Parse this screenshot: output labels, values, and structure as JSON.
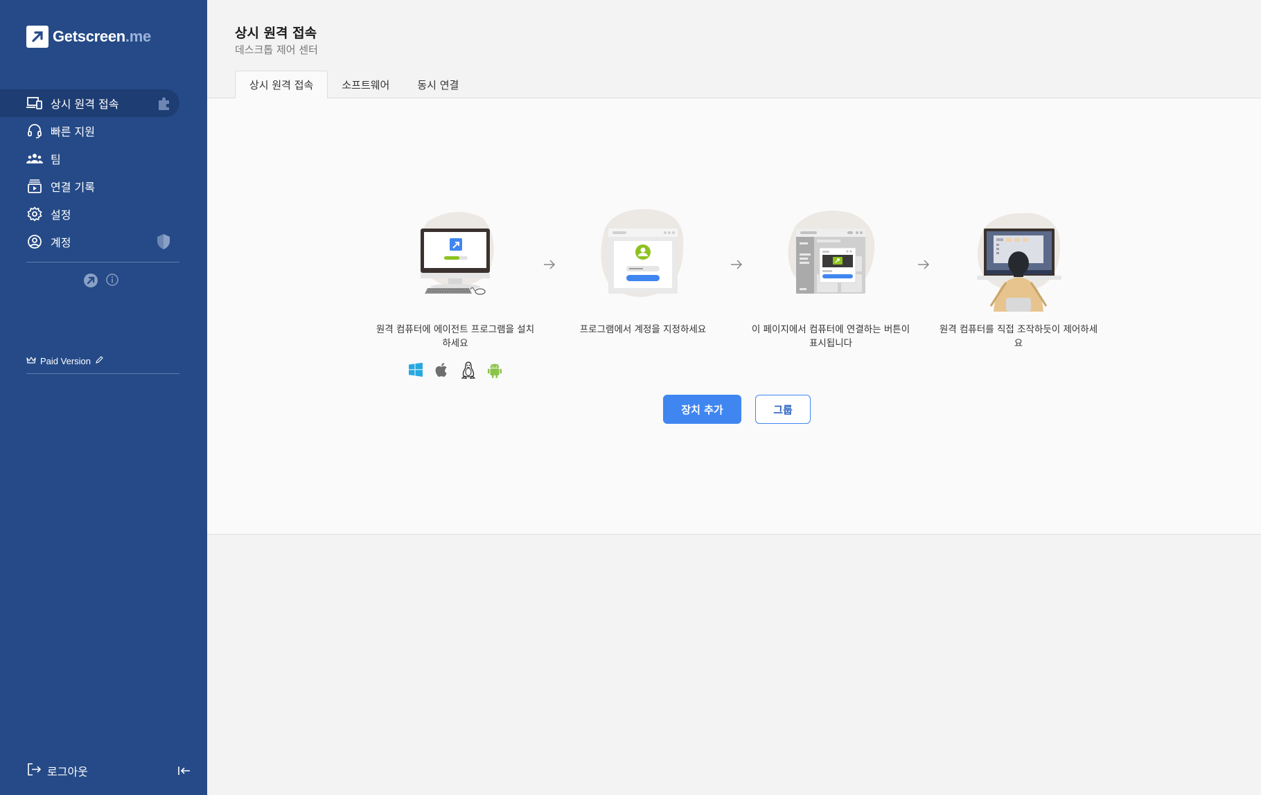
{
  "sidebar": {
    "logo": {
      "brand": "Getscreen",
      "suffix": ".me"
    },
    "items": [
      {
        "label": "상시 원격 접속",
        "icon": "devices-icon",
        "active": true
      },
      {
        "label": "빠른 지원",
        "icon": "headset-icon",
        "active": false
      },
      {
        "label": "팀",
        "icon": "team-icon",
        "active": false
      },
      {
        "label": "연결 기록",
        "icon": "history-icon",
        "active": false
      },
      {
        "label": "설정",
        "icon": "gear-icon",
        "active": false
      },
      {
        "label": "계정",
        "icon": "account-icon",
        "active": false
      }
    ],
    "paid_label": "Paid Version",
    "logout_label": "로그아웃"
  },
  "header": {
    "title": "상시 원격 접속",
    "subtitle": "데스크톱 제어 센터"
  },
  "tabs": [
    {
      "label": "상시 원격 접속",
      "active": true
    },
    {
      "label": "소프트웨어",
      "active": false
    },
    {
      "label": "동시 연결",
      "active": false
    }
  ],
  "steps": [
    {
      "caption": "원격 컴퓨터에 에이전트 프로그램을 설치하세요"
    },
    {
      "caption": "프로그램에서 계정을 지정하세요"
    },
    {
      "caption": "이 페이지에서 컴퓨터에 연결하는 버튼이 표시됩니다"
    },
    {
      "caption": "원격 컴퓨터를 직접 조작하듯이 제어하세요"
    }
  ],
  "os_icons": [
    "windows-icon",
    "apple-icon",
    "linux-icon",
    "android-icon"
  ],
  "actions": {
    "add_device": "장치 추가",
    "group": "그룹"
  },
  "colors": {
    "sidebar_bg": "#254a87",
    "sidebar_active": "#1e3d73",
    "primary": "#3f86f0",
    "accent_green": "#8dc21f"
  }
}
